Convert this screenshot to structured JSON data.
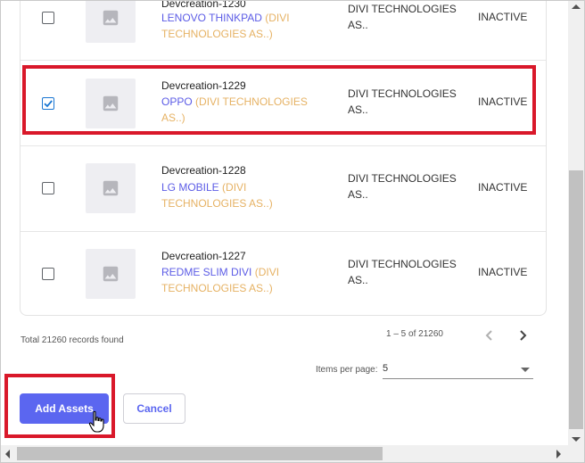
{
  "assets": [
    {
      "title": "Devcreation-1230",
      "model": "LENOVO THINKPAD",
      "owner": "(DIVI TECHNOLOGIES AS..)",
      "company": "DIVI TECHNOLOGIES AS..",
      "status": "INACTIVE",
      "checked": false
    },
    {
      "title": "Devcreation-1229",
      "model": "OPPO",
      "owner": "(DIVI TECHNOLOGIES AS..)",
      "company": "DIVI TECHNOLOGIES AS..",
      "status": "INACTIVE",
      "checked": true
    },
    {
      "title": "Devcreation-1228",
      "model": "LG MOBILE",
      "owner": "(DIVI TECHNOLOGIES AS..)",
      "company": "DIVI TECHNOLOGIES AS..",
      "status": "INACTIVE",
      "checked": false
    },
    {
      "title": "Devcreation-1227",
      "model": "REDME SLIM DIVI",
      "owner": "(DIVI TECHNOLOGIES AS..)",
      "company": "DIVI TECHNOLOGIES AS..",
      "status": "INACTIVE",
      "checked": false
    }
  ],
  "footer": {
    "total_records": "Total 21260 records found",
    "range": "1 – 5 of 21260",
    "items_per_page_label": "Items per page:",
    "items_per_page_value": "5"
  },
  "actions": {
    "add_label": "Add Assets",
    "cancel_label": "Cancel"
  },
  "colors": {
    "primary": "#5b66f0",
    "model_link": "#5c5ce6",
    "owner_text": "#e6b264",
    "highlight": "#d9182a"
  },
  "icons": {
    "thumbnail": "image-placeholder-icon",
    "prev": "chevron-left-icon",
    "next": "chevron-right-icon",
    "check": "checkmark-icon",
    "cursor": "hand-pointer-icon"
  }
}
